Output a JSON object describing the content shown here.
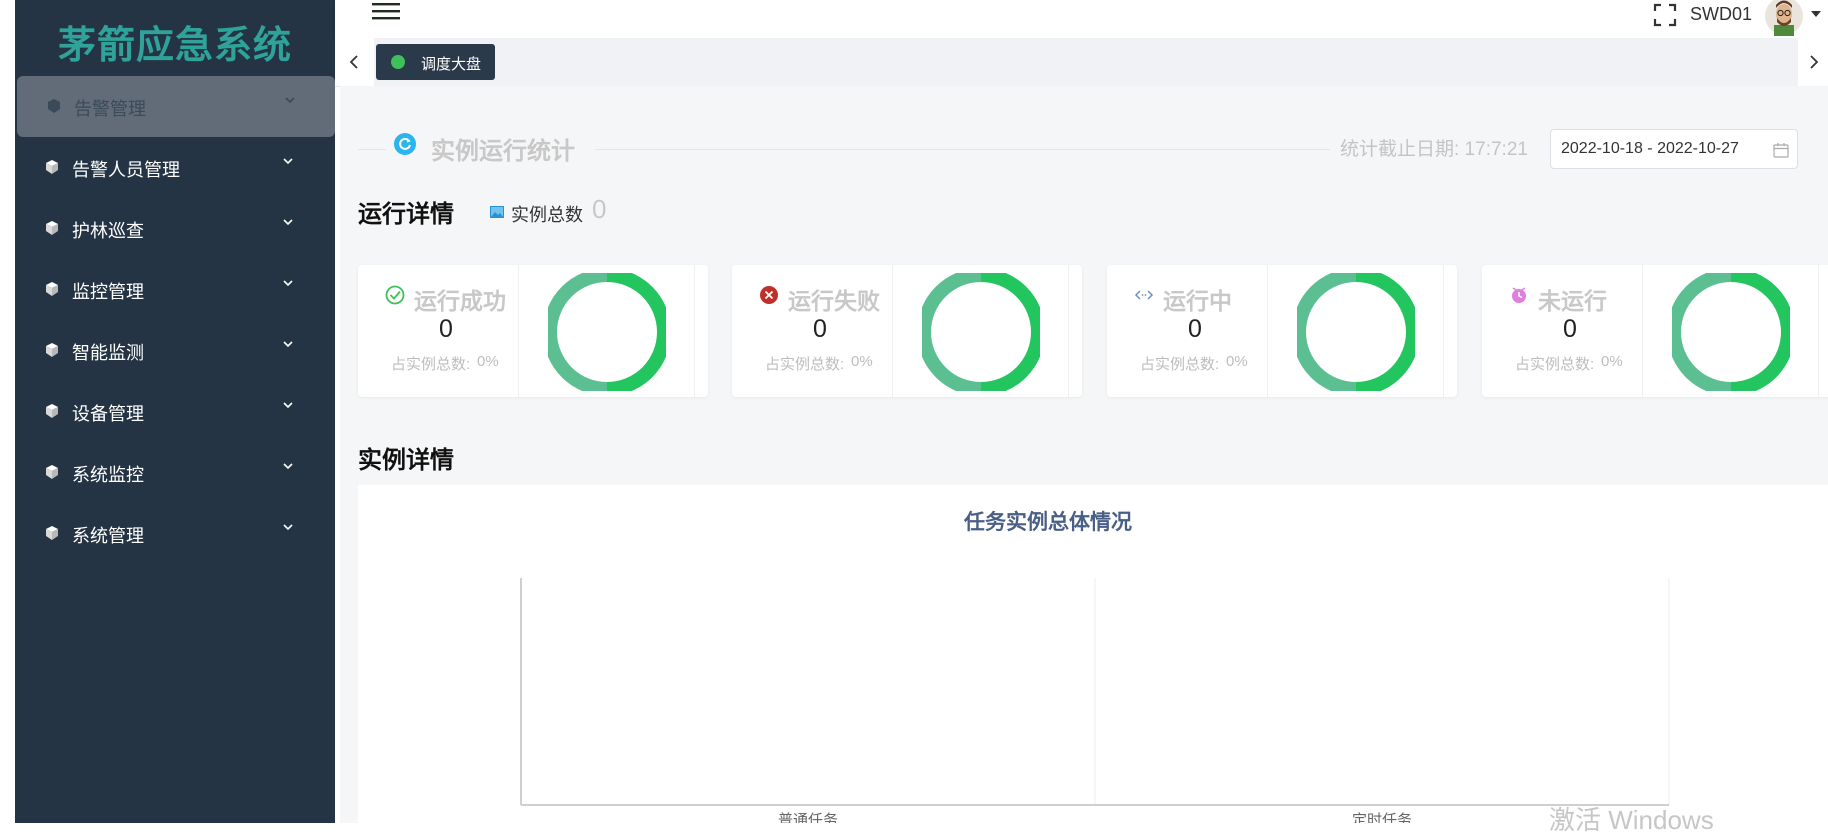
{
  "app": {
    "title": "茅箭应急系统"
  },
  "sidebar": {
    "items": [
      {
        "label": "告警管理",
        "active": true
      },
      {
        "label": "告警人员管理"
      },
      {
        "label": "护林巡查"
      },
      {
        "label": "监控管理"
      },
      {
        "label": "智能监测"
      },
      {
        "label": "设备管理"
      },
      {
        "label": "系统监控"
      },
      {
        "label": "系统管理"
      }
    ]
  },
  "header": {
    "username": "SWD01"
  },
  "tabs": [
    {
      "label": "调度大盘",
      "active": true,
      "dot_color": "#3ec05a"
    }
  ],
  "stats": {
    "title": "实例运行统计",
    "deadline_label": "统计截止日期: 17:7:21",
    "date_range": "2022-10-18 - 2022-10-27"
  },
  "run_details": {
    "title": "运行详情",
    "total_label": "实例总数",
    "total_value": "0",
    "cards": [
      {
        "label": "运行成功",
        "value": "0",
        "pct_label": "占实例总数:",
        "pct": "0%",
        "icon": "check-circle-icon",
        "icon_color": "#3ec05a"
      },
      {
        "label": "运行失败",
        "value": "0",
        "pct_label": "占实例总数:",
        "pct": "0%",
        "icon": "error-circle-icon",
        "icon_color": "#c0302a"
      },
      {
        "label": "运行中",
        "value": "0",
        "pct_label": "占实例总数:",
        "pct": "0%",
        "icon": "code-icon",
        "icon_color": "#6c8fc7"
      },
      {
        "label": "未运行",
        "value": "0",
        "pct_label": "占实例总数:",
        "pct": "0%",
        "icon": "clock-icon",
        "icon_color": "#e07de0"
      }
    ]
  },
  "instance_details": {
    "title": "实例详情"
  },
  "chart_data": {
    "type": "bar",
    "title": "任务实例总体情况",
    "categories": [
      "普通任务",
      "定时任务"
    ],
    "values": [
      0,
      0
    ],
    "grid": true
  },
  "colors": {
    "sidebar_bg": "#243444",
    "logo": "#2fa39a",
    "donut_light": "#5bbf92",
    "donut_dark": "#22c55e"
  },
  "watermark": "激活 Windows"
}
